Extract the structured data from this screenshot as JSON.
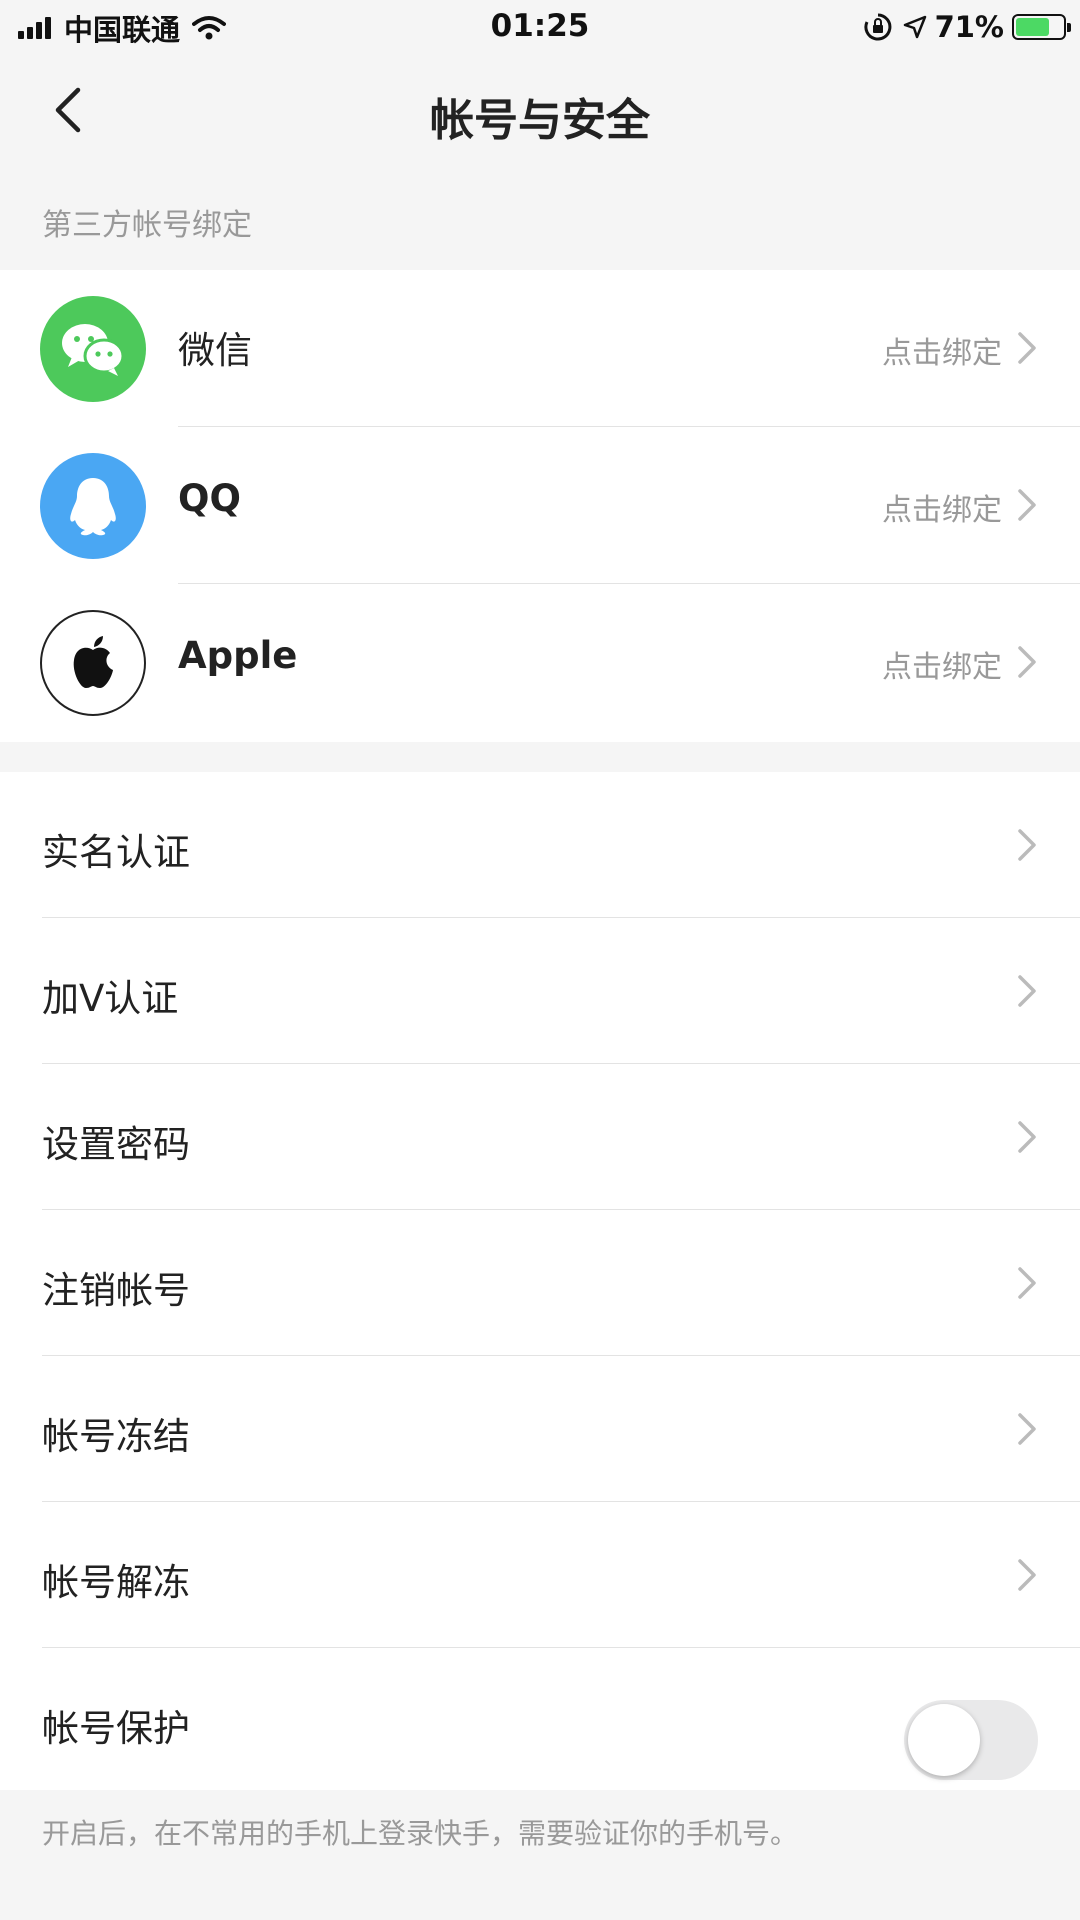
{
  "status_bar": {
    "carrier": "中国联通",
    "time": "01:25",
    "battery": "71%",
    "battery_level": 0.71
  },
  "nav": {
    "title": "帐号与安全",
    "back_icon": "chevron-left-icon"
  },
  "third_party": {
    "header": "第三方帐号绑定",
    "items": [
      {
        "label": "微信",
        "action": "点击绑定",
        "icon": "wechat-icon",
        "color": "#4dc95b"
      },
      {
        "label": "QQ",
        "action": "点击绑定",
        "icon": "qq-icon",
        "color": "#4aa7f3"
      },
      {
        "label": "Apple",
        "action": "点击绑定",
        "icon": "apple-icon",
        "color": "#111111"
      }
    ]
  },
  "settings": {
    "items": [
      {
        "label": "实名认证"
      },
      {
        "label": "加V认证"
      },
      {
        "label": "设置密码"
      },
      {
        "label": "注销帐号"
      },
      {
        "label": "帐号冻结"
      },
      {
        "label": "帐号解冻"
      }
    ],
    "protection": {
      "label": "帐号保护",
      "enabled": false
    }
  },
  "footer": {
    "note": "开启后，在不常用的手机上登录快手，需要验证你的手机号。"
  }
}
